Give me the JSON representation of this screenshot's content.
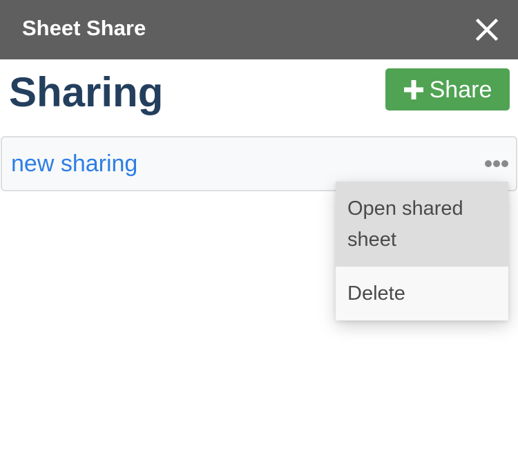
{
  "window": {
    "title": "Sheet Share",
    "close_icon": "close-icon"
  },
  "header": {
    "title": "Sharing",
    "share_button_label": "Share",
    "share_button_icon": "plus-icon"
  },
  "shares": [
    {
      "name": "new sharing"
    }
  ],
  "context_menu": {
    "items": [
      {
        "label": "Open shared sheet"
      },
      {
        "label": "Delete"
      }
    ]
  },
  "colors": {
    "titlebar": "#5f5f5f",
    "page_title": "#243f5e",
    "share_button": "#4fa353",
    "link": "#2d7ee6",
    "menu_highlight": "#dddddd"
  }
}
